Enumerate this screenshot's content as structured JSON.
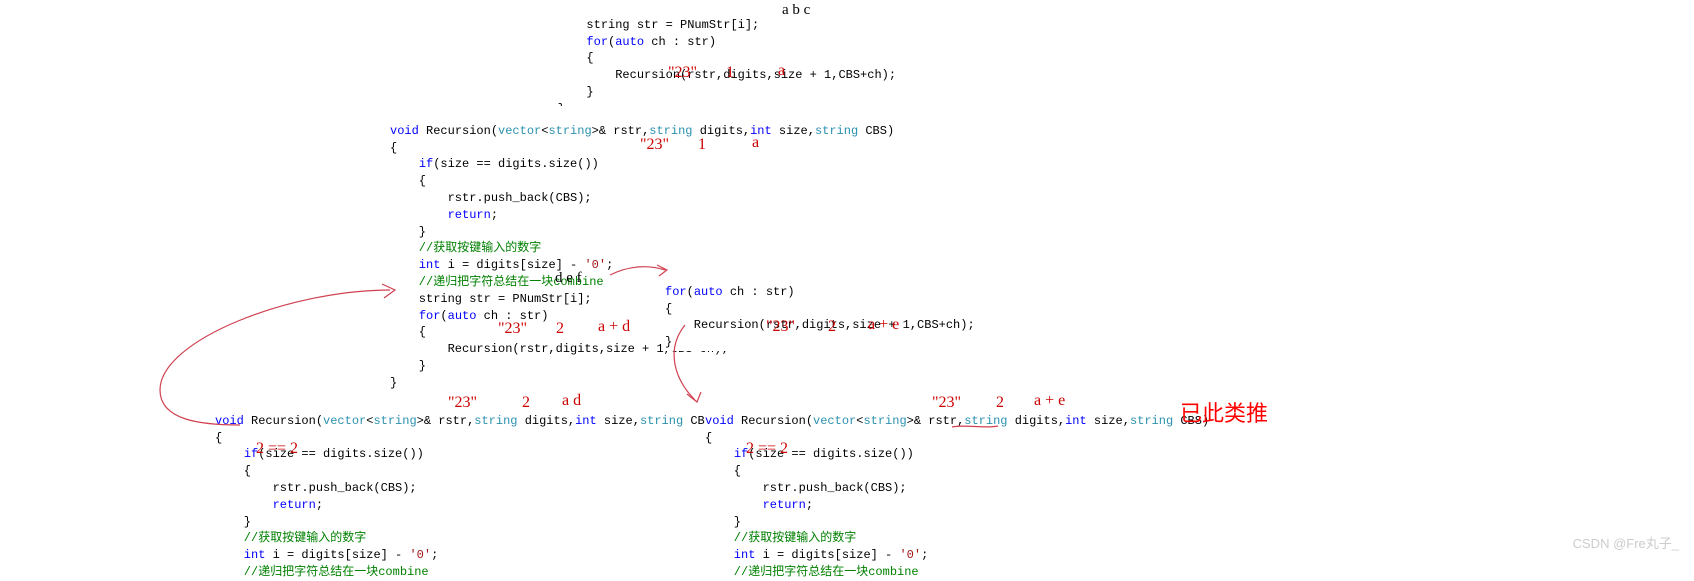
{
  "block1": {
    "l1a": "            string str = PNumStr[i];",
    "l2": "            for(auto ch : str)",
    "l3": "            {",
    "l4": "                Recursion(rstr,digits,size + 1,CBS+ch);",
    "l5": "            }",
    "l6": "        }"
  },
  "ann_abc": "a b c",
  "ann_23_1a": "\"23\"",
  "ann_1a": "1",
  "ann_a1": "a",
  "sig": {
    "void": "void",
    "name": " Recursion(",
    "vec": "vector",
    "lt": "<",
    "string": "string",
    "gt": ">& rstr,",
    "p2": " digits,",
    "int": "int",
    "p3": " size,",
    "p4": " CBS)"
  },
  "block2": {
    "l2": "{",
    "l3a": "    if(size == digits.size())",
    "l4": "    {",
    "l5": "        rstr.push_back(CBS);",
    "l6a": "        return",
    "l6b": ";",
    "l7": "    }",
    "c1": "    //获取按键输入的数字",
    "l8a": "    int",
    "l8b": " i = digits[size] - ",
    "l8c": "'0'",
    "l8d": ";",
    "c2a": "    //递归把字符总结在一块",
    "c2b": "combine",
    "l9": "    string str = PNumStr[i];",
    "l10": "    for(auto ch : str)",
    "l11": "    {",
    "l12": "        Recursion(rstr,digits,size + 1,CBS+ch);",
    "l13": "    }",
    "l14": "}"
  },
  "ann_23_1b": "\"23\"",
  "ann_1b": "1",
  "ann_a2": "a",
  "ann_def": "d e f",
  "ann_23_2a": "\"23\"",
  "ann_2a": "2",
  "ann_ad": "a + d",
  "block2r": {
    "l1": "for(auto ch : str)",
    "l2": "{",
    "l3": "    Recursion(rstr,digits,size + 1,CBS+ch);",
    "l4": "}"
  },
  "ann_23_2b": "\"23\"",
  "ann_2b": "2",
  "ann_ae": "a + e",
  "ann_22_l": "2   ==  2",
  "ann_23_2c": "\"23\"",
  "ann_2c": "2",
  "ann_ad2": "a d",
  "ann_22_r": "2   ==  2",
  "ann_23_2d": "\"23\"",
  "ann_2d": "2",
  "ann_ae2": "a + e",
  "big": "已此类推",
  "watermark": "CSDN @Fre丸子_"
}
